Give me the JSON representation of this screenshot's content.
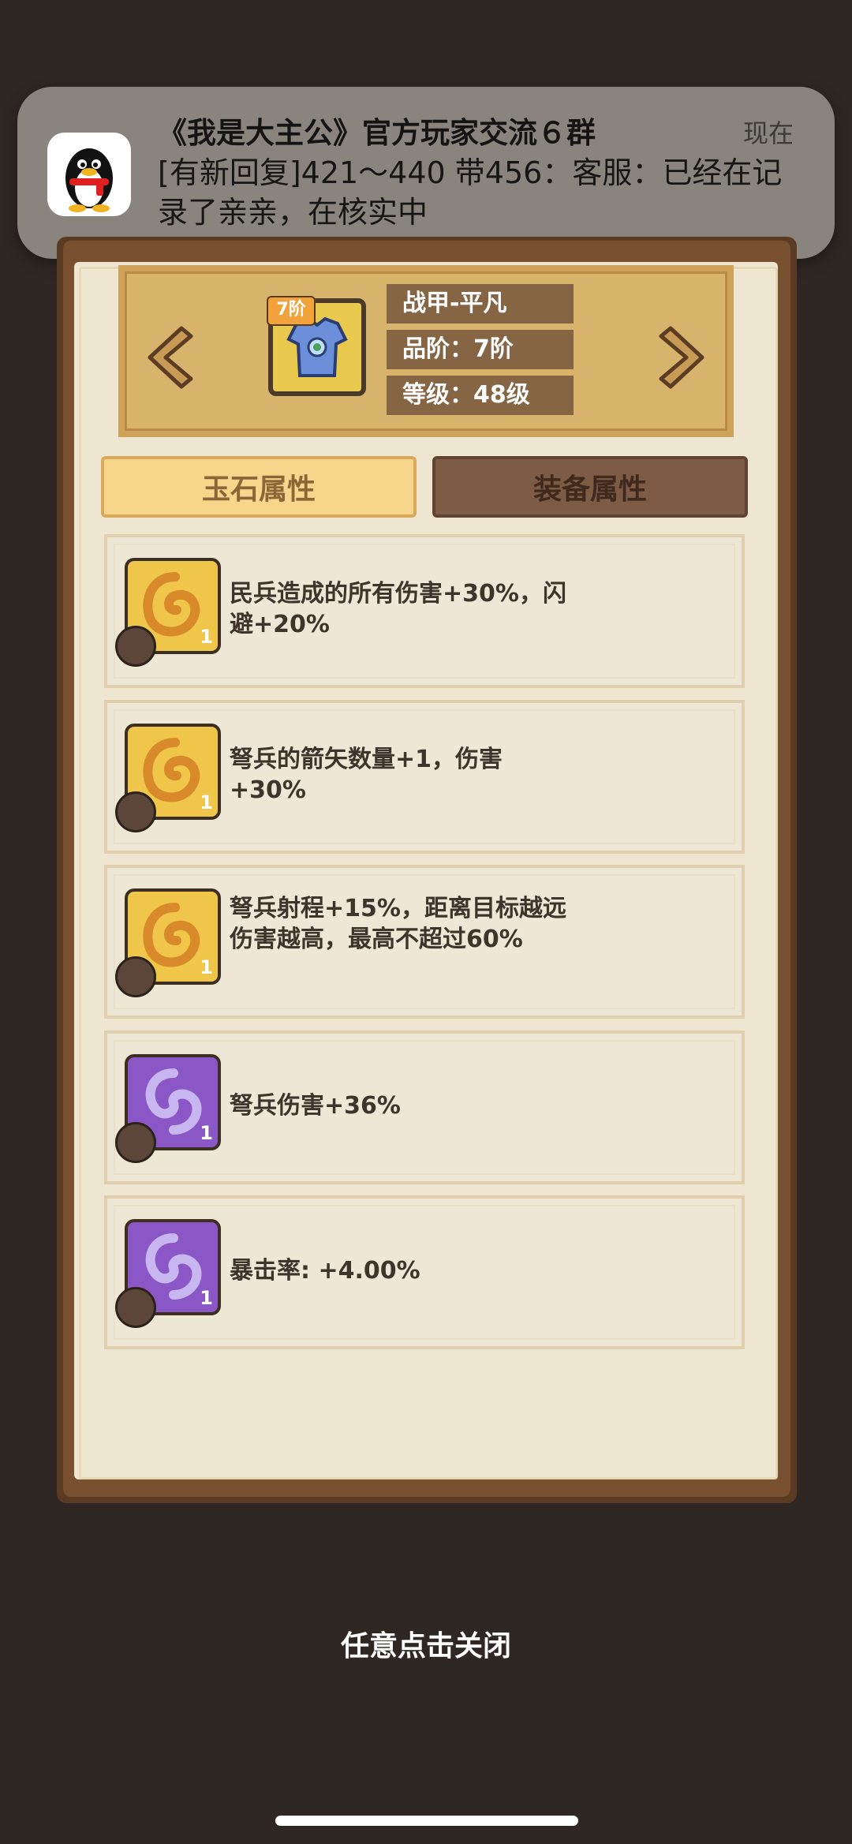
{
  "notification": {
    "title": "《我是大主公》官方玩家交流６群",
    "time": "现在",
    "body": "[有新回复]421～440 带456：客服：已经在记录了亲亲，在核实中",
    "icon": "qq-penguin-icon"
  },
  "equipment": {
    "name": "战甲-平凡",
    "grade": "品阶：7阶",
    "level": "等级：48级",
    "badge": "7阶"
  },
  "tabs": [
    {
      "label": "玉石属性",
      "selected": true
    },
    {
      "label": "装备属性",
      "selected": false
    }
  ],
  "attributes": [
    {
      "text": "民兵造成的所有伤害+30%，闪避+20%",
      "gem": "gold",
      "count": "1"
    },
    {
      "text": "弩兵的箭矢数量+1，伤害+30%",
      "gem": "gold",
      "count": "1"
    },
    {
      "text": "弩兵射程+15%，距离目标越远伤害越高，最高不超过60%",
      "gem": "gold",
      "count": "1"
    },
    {
      "text": "弩兵伤害+36%",
      "gem": "purple",
      "count": "1"
    },
    {
      "text": "暴击率: +4.00%",
      "gem": "purple",
      "count": "1"
    }
  ],
  "close_hint": "任意点击关闭"
}
